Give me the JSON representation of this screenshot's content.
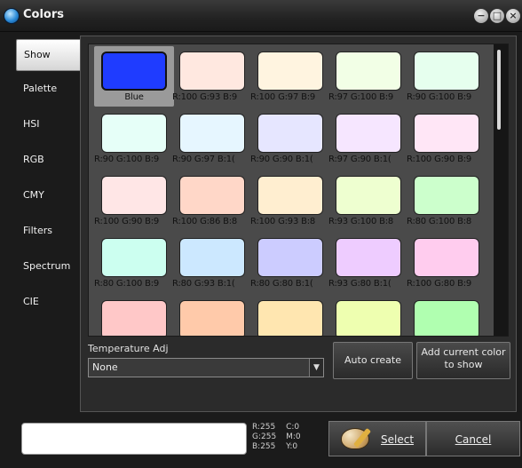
{
  "window": {
    "title": "Colors"
  },
  "nav": {
    "items": [
      {
        "label": "Show",
        "active": true
      },
      {
        "label": "Palette",
        "active": false
      },
      {
        "label": "HSI",
        "active": false
      },
      {
        "label": "RGB",
        "active": false
      },
      {
        "label": "CMY",
        "active": false
      },
      {
        "label": "Filters",
        "active": false
      },
      {
        "label": "Spectrum",
        "active": false
      },
      {
        "label": "CIE",
        "active": false
      }
    ]
  },
  "swatches": [
    {
      "color": "#1f3cff",
      "label": "Blue",
      "selected": true
    },
    {
      "color": "#ffe8e0",
      "label": "R:100 G:93 B:9"
    },
    {
      "color": "#fff4e0",
      "label": "R:100 G:97 B:9"
    },
    {
      "color": "#f2ffe6",
      "label": "R:97 G:100 B:9"
    },
    {
      "color": "#e6ffee",
      "label": "R:90 G:100 B:9"
    },
    {
      "color": "#e6fff8",
      "label": "R:90 G:100 B:9"
    },
    {
      "color": "#e6f6ff",
      "label": "R:90 G:97 B:1("
    },
    {
      "color": "#e6e6ff",
      "label": "R:90 G:90 B:1("
    },
    {
      "color": "#f6e6ff",
      "label": "R:97 G:90 B:1("
    },
    {
      "color": "#ffe6f6",
      "label": "R:100 G:90 B:9"
    },
    {
      "color": "#ffe6e6",
      "label": "R:100 G:90 B:9"
    },
    {
      "color": "#ffd7c8",
      "label": "R:100 G:86 B:8"
    },
    {
      "color": "#ffeed0",
      "label": "R:100 G:93 B:8"
    },
    {
      "color": "#eeffd0",
      "label": "R:93 G:100 B:8"
    },
    {
      "color": "#ccffcc",
      "label": "R:80 G:100 B:8"
    },
    {
      "color": "#ccfff0",
      "label": "R:80 G:100 B:9"
    },
    {
      "color": "#cce8ff",
      "label": "R:80 G:93 B:1("
    },
    {
      "color": "#ccccff",
      "label": "R:80 G:80 B:1("
    },
    {
      "color": "#eeccff",
      "label": "R:93 G:80 B:1("
    },
    {
      "color": "#ffccee",
      "label": "R:100 G:80 B:9"
    },
    {
      "color": "#ffc8c8",
      "label": ""
    },
    {
      "color": "#ffcaaa",
      "label": ""
    },
    {
      "color": "#ffe6b0",
      "label": ""
    },
    {
      "color": "#eeffb0",
      "label": ""
    },
    {
      "color": "#b0ffb0",
      "label": ""
    }
  ],
  "temperature": {
    "label": "Temperature Adj",
    "value": "None"
  },
  "buttons": {
    "auto_create": "Auto create",
    "add_current_line1": "Add current color",
    "add_current_line2": "to show",
    "select": "Select",
    "cancel": "Cancel"
  },
  "current_color": {
    "r_text": "R:255",
    "g_text": "G:255",
    "b_text": "B:255",
    "c_text": "C:0",
    "m_text": "M:0",
    "y_text": "Y:0"
  },
  "colors": {
    "background": "#1b1b1b",
    "grid_background": "#4a4a4a"
  }
}
